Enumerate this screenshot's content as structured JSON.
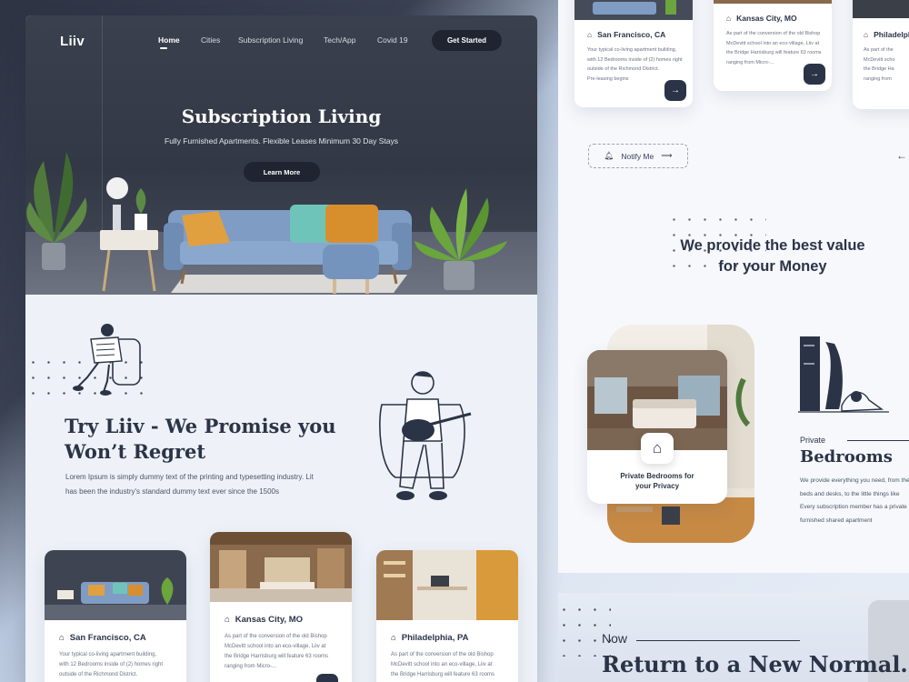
{
  "nav": {
    "logo": "Liiv",
    "items": [
      "Home",
      "Cities",
      "Subscription Living",
      "Tech/App",
      "Covid 19"
    ],
    "cta": "Get Started"
  },
  "hero": {
    "title": "Subscription Living",
    "subtitle": "Fully Furnished Apartments. Flexible Leases Minimum 30 Day Stays",
    "button": "Learn More"
  },
  "promise": {
    "title_line1": "Try Liiv - We Promise you",
    "title_line2": "Won’t Regret",
    "body_line1": "Lorem Ipsum is simply dummy text of the printing and typesetting industry. Lit",
    "body_line2": "has been the industry's standard dummy text ever since the 1500s"
  },
  "cards": [
    {
      "city": "San Francisco, CA",
      "lines": [
        "Your typical co-living apartment building,",
        "with 12 Bedrooms inside of (2) homes right",
        "outside of the Richmond District."
      ]
    },
    {
      "city": "Kansas City, MO",
      "lines": [
        "As part of the conversion of the old Bishop",
        "McDevitt school into an eco-village, Liiv at",
        "the Bridge Harrisburg will feature 63 rooms",
        "ranging from Micro-..."
      ]
    },
    {
      "city": "Philadelphia, PA",
      "lines": [
        "As part of the conversion of the old Bishop",
        "McDevitt school into an eco-village, Liiv at",
        "the Bridge Harrisburg will feature 63 rooms"
      ]
    }
  ],
  "right_cards": [
    {
      "city": "San Francisco, CA",
      "lines": [
        "Your typical co-living apartment building,",
        "with 12 Bedrooms inside of (2) homes right",
        "outside of the Richmond District.",
        "Pre-leasing begins"
      ]
    },
    {
      "city": "Kansas City, MO",
      "lines": [
        "As part of the conversion of the old Bishop",
        "McDevitt school into an eco-village, Liiv at",
        "the Bridge Harrisburg will feature 63 rooms",
        "ranging from Micro-..."
      ]
    },
    {
      "city": "Philadelph",
      "lines": [
        "As part of the",
        "McDevitt scho",
        "the Bridge Ha",
        "ranging from"
      ]
    }
  ],
  "notify": {
    "label": "Notify Me"
  },
  "value": {
    "line1": "We provide the best value",
    "line2": "for your Money"
  },
  "privacy": {
    "card_line1": "Private Bedrooms for",
    "card_line2": "your Privacy"
  },
  "bedrooms": {
    "label": "Private",
    "title": "Bedrooms",
    "lines": [
      "We provide everything you need, from the",
      "beds and desks, to the little things like",
      "Every subscription member has a private",
      "furnished shared apartment"
    ]
  },
  "normal": {
    "label": "Now",
    "title": "Return to a New Normal."
  },
  "colors": {
    "navy": "#2b3447",
    "hero_bg": "#353b48",
    "panel": "#eef2f8"
  }
}
